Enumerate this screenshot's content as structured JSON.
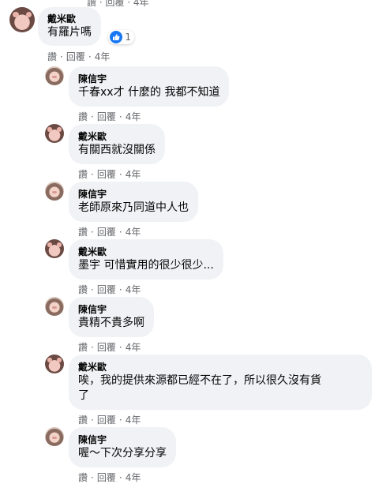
{
  "colors": {
    "bubble": "#f0f2f5",
    "meta": "#65676b",
    "like": "#1877f2"
  },
  "top_clip": "讚 · 回覆 · 4年",
  "actions": {
    "like": "讚",
    "reply": "回覆",
    "dot": "·"
  },
  "comments": [
    {
      "author": "戴米歐",
      "text": "有羅片嗎",
      "time": "4年",
      "avatar": "pig-avatar-dai",
      "reactions": {
        "icon": "like-icon",
        "count": "1"
      }
    },
    {
      "author": "陳信宇",
      "text": "千春xx才 什麼的 我都不知道",
      "time": "4年",
      "avatar": "pig-avatar-chen"
    },
    {
      "author": "戴米歐",
      "text": "有關西就沒關係",
      "time": "4年",
      "avatar": "pig-avatar-dai"
    },
    {
      "author": "陳信宇",
      "text": "老師原來乃同道中人也",
      "time": "4年",
      "avatar": "pig-avatar-chen"
    },
    {
      "author": "戴米歐",
      "text": "墨宇 可惜實用的很少很少...",
      "time": "4年",
      "avatar": "pig-avatar-dai"
    },
    {
      "author": "陳信宇",
      "text": "貴精不貴多啊",
      "time": "4年",
      "avatar": "pig-avatar-chen"
    },
    {
      "author": "戴米歐",
      "text": "唉，我的提供來源都已經不在了，所以很久沒有貨\n了",
      "time": "4年",
      "avatar": "pig-avatar-dai"
    },
    {
      "author": "陳信宇",
      "text": "喔～下次分享分享",
      "time": "4年",
      "avatar": "pig-avatar-chen"
    }
  ]
}
